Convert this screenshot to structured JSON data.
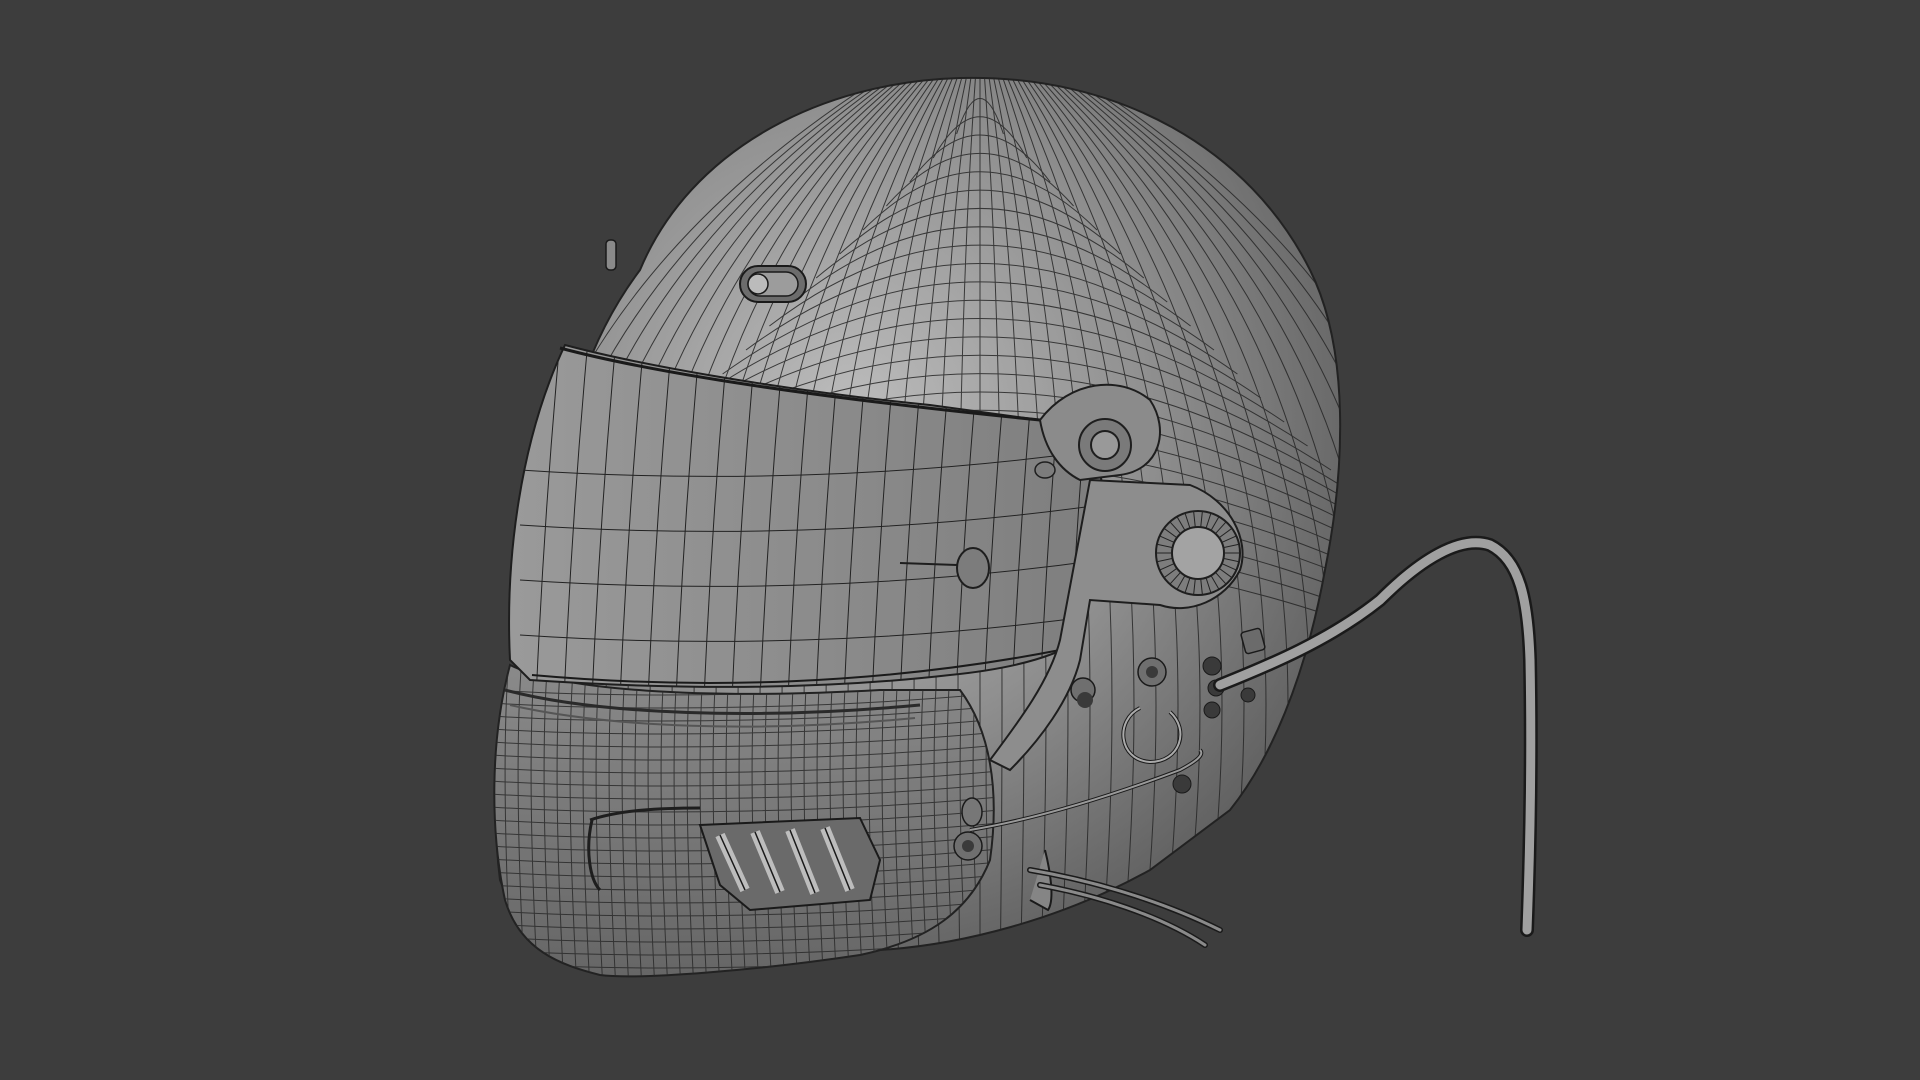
{
  "viewport": {
    "background": "#3d3d3d",
    "subject": "helmet-wireframe"
  },
  "colors": {
    "shell_fill": "#8e8e8e",
    "shell_highlight": "#b8b8b8",
    "shell_shadow": "#5f5f5f",
    "wire": "#1e1e1e",
    "visor_fill": "#8a8a8a",
    "cable": "#9a9a9a"
  }
}
